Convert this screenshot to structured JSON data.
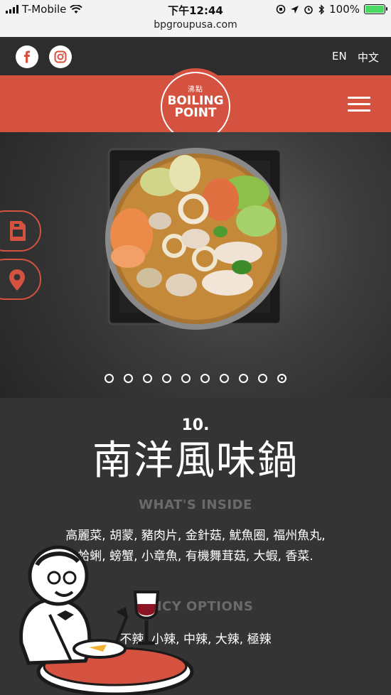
{
  "status_bar": {
    "carrier": "T-Mobile",
    "time": "下午12:44",
    "battery": "100%",
    "url": "bpgroupusa.com"
  },
  "header": {
    "lang_en": "EN",
    "lang_zh": "中文",
    "logo": {
      "chinese": "沸點",
      "line1": "BOILING",
      "line2": "POINT"
    }
  },
  "carousel": {
    "count": 10,
    "active_index": 9
  },
  "dish": {
    "number": "10.",
    "name": "南洋風味鍋",
    "inside_heading": "WHAT'S INSIDE",
    "ingredients": "高麗菜, 胡蒙, 豬肉片, 金針菇, 魷魚圈, 福州魚丸, 蛤蜊, 螃蟹, 小章魚, 有機舞茸菇, 大蝦, 香菜.",
    "spicy_heading": "SPICY OPTIONS",
    "spicy_options": "不辣, 小辣, 中辣, 大辣, 極辣"
  },
  "colors": {
    "brand_red": "#d4523f",
    "bg_dark": "#343434"
  }
}
